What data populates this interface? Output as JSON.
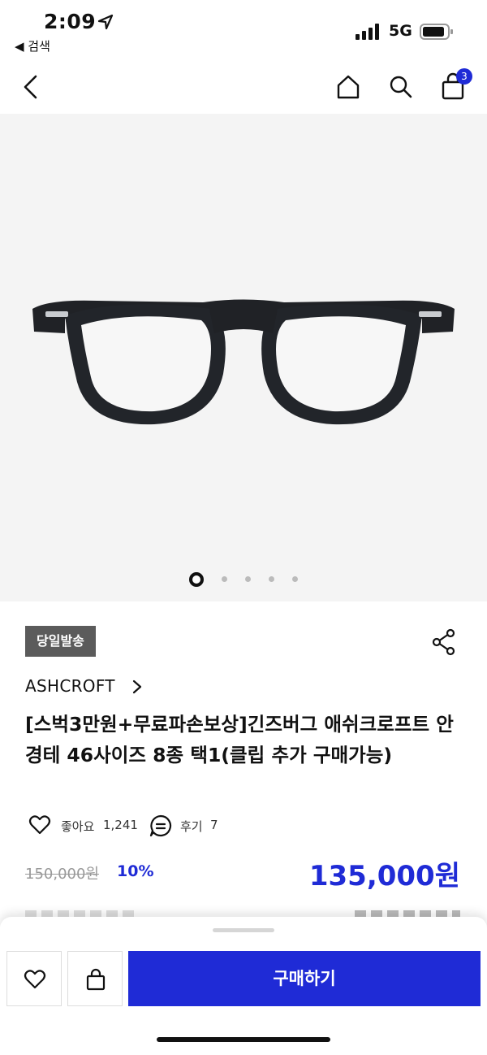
{
  "status": {
    "time": "2:09",
    "back_app": "◀ 검색",
    "network": "5G"
  },
  "nav": {
    "cart_count": "3"
  },
  "gallery": {
    "slide_count": 5,
    "active_index": 0
  },
  "product": {
    "badge": "당일발송",
    "brand": "ASHCROFT",
    "title": "[스벅3만원+무료파손보상]긴즈버그 애쉬크로프트 안경테 46사이즈 8종 택1(클립 추가 구매가능)",
    "likes_label": "좋아요",
    "likes_count": "1,241",
    "reviews_label": "후기",
    "reviews_count": "7",
    "original_price": "150,000원",
    "discount": "10%",
    "price": "135,000원"
  },
  "bottom_bar": {
    "buy_label": "구매하기"
  },
  "colors": {
    "accent": "#1f2bd6",
    "badge_bg": "#5b5b5b",
    "hero_bg": "#f4f4f4"
  }
}
